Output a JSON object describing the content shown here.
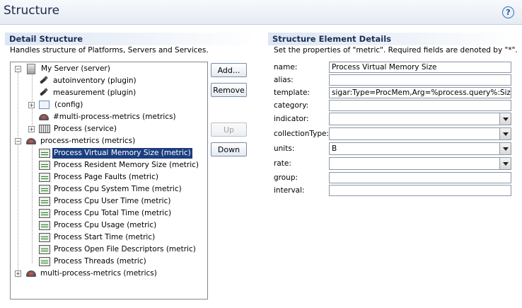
{
  "header": {
    "title": "Structure",
    "help_icon": "?"
  },
  "detail": {
    "title": "Detail Structure",
    "description": "Handles structure of Platforms, Servers and Services."
  },
  "tree": {
    "nodes": [
      {
        "label": "My Server (server)",
        "icon": "server-icon"
      },
      {
        "label": "autoinventory (plugin)",
        "icon": "plugin-icon"
      },
      {
        "label": "measurement (plugin)",
        "icon": "plugin-icon"
      },
      {
        "label": "(config)",
        "icon": "config-icon"
      },
      {
        "label": "#multi-process-metrics (metrics)",
        "icon": "metrics-icon"
      },
      {
        "label": "Process (service)",
        "icon": "service-icon"
      },
      {
        "label": "process-metrics (metrics)",
        "icon": "metrics-icon"
      },
      {
        "label": "Process Virtual Memory Size (metric)",
        "icon": "metric-icon",
        "selected": true
      },
      {
        "label": "Process Resident Memory Size (metric)",
        "icon": "metric-icon"
      },
      {
        "label": "Process Page Faults (metric)",
        "icon": "metric-icon"
      },
      {
        "label": "Process Cpu System Time (metric)",
        "icon": "metric-icon"
      },
      {
        "label": "Process Cpu User Time (metric)",
        "icon": "metric-icon"
      },
      {
        "label": "Process Cpu Total Time (metric)",
        "icon": "metric-icon"
      },
      {
        "label": "Process Cpu Usage (metric)",
        "icon": "metric-icon"
      },
      {
        "label": "Process Start Time (metric)",
        "icon": "metric-icon"
      },
      {
        "label": "Process Open File Descriptors (metric)",
        "icon": "metric-icon"
      },
      {
        "label": "Process Threads (metric)",
        "icon": "metric-icon"
      },
      {
        "label": "multi-process-metrics (metrics)",
        "icon": "metrics-icon"
      }
    ]
  },
  "buttons": {
    "add": "Add...",
    "remove": "Remove",
    "up": "Up",
    "down": "Down"
  },
  "element": {
    "title": "Structure Element Details",
    "description": "Set the properties of \"metric\". Required fields are denoted by \"*\".",
    "fields": {
      "name": {
        "label": "name:",
        "value": "Process Virtual Memory Size"
      },
      "alias": {
        "label": "alias:",
        "value": ""
      },
      "template": {
        "label": "template:",
        "value": "sigar:Type=ProcMem,Arg=%process.query%:Size"
      },
      "category": {
        "label": "category:",
        "value": ""
      },
      "indicator": {
        "label": "indicator:",
        "value": ""
      },
      "collectionType": {
        "label": "collectionType:",
        "value": ""
      },
      "units": {
        "label": "units:",
        "value": "B"
      },
      "rate": {
        "label": "rate:",
        "value": ""
      },
      "group": {
        "label": "group:",
        "value": ""
      },
      "interval": {
        "label": "interval:",
        "value": ""
      }
    }
  },
  "colors": {
    "selection": "#1c3e7e",
    "section_header": "#dde6f3",
    "title_text": "#1a2f55"
  }
}
